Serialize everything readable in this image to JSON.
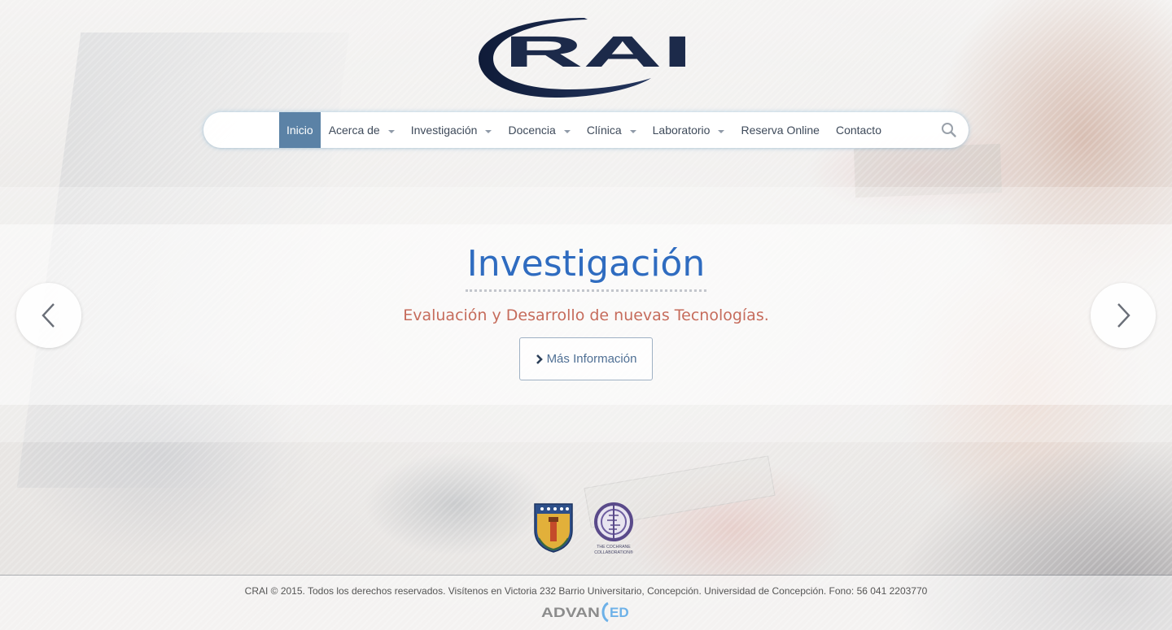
{
  "header": {
    "logo_text": "RAI",
    "logo_color": "#1c2a4a"
  },
  "nav": {
    "items": [
      {
        "label": "Inicio",
        "active": true,
        "has_dropdown": false
      },
      {
        "label": "Acerca de",
        "active": false,
        "has_dropdown": true
      },
      {
        "label": "Investigación",
        "active": false,
        "has_dropdown": true
      },
      {
        "label": "Docencia",
        "active": false,
        "has_dropdown": true
      },
      {
        "label": "Clínica",
        "active": false,
        "has_dropdown": true
      },
      {
        "label": "Laboratorio",
        "active": false,
        "has_dropdown": true
      },
      {
        "label": "Reserva Online",
        "active": false,
        "has_dropdown": false
      },
      {
        "label": "Contacto",
        "active": false,
        "has_dropdown": false
      }
    ],
    "search_icon": "search-icon",
    "active_color": "#5b82a6"
  },
  "hero": {
    "title": "Investigación",
    "subtitle": "Evaluación y Desarrollo de nuevas Tecnologías.",
    "button_label": "Más Información",
    "title_color": "#2f6cc0",
    "subtitle_color": "#c66c5c",
    "prev_icon": "chevron-left-icon",
    "next_icon": "chevron-right-icon"
  },
  "partners": [
    {
      "name": "university-crest-logo"
    },
    {
      "name": "cochrane-collaboration-logo",
      "text": "THE COCHRANE COLLABORATION®"
    }
  ],
  "footer": {
    "text": "CRAI © 2015. Todos los derechos reservados. Visítenos en Victoria 232 Barrio Universitario, Concepción. Universidad de Concepción. Fono: 56 041 2203770",
    "brand_left": "ADVAN",
    "brand_right": "ED"
  }
}
